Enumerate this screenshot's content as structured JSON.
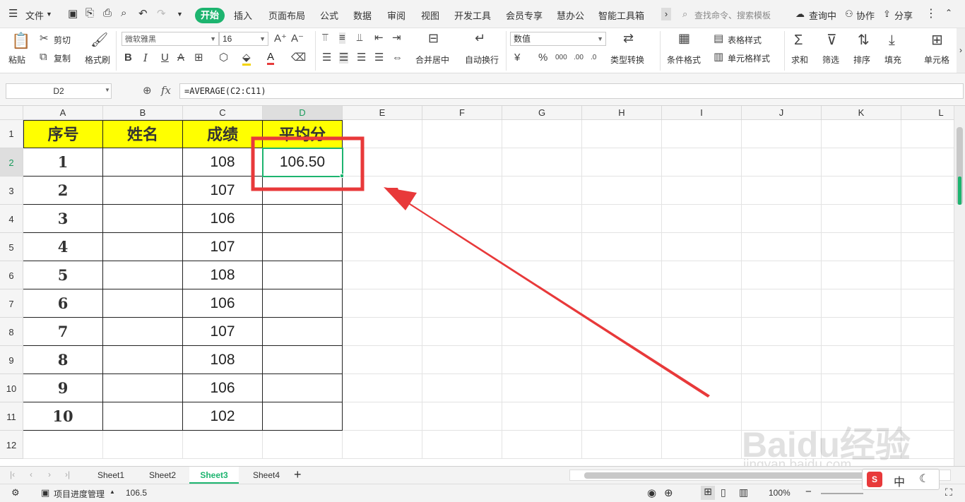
{
  "menubar": {
    "file_label": "文件",
    "tabs": [
      "开始",
      "插入",
      "页面布局",
      "公式",
      "数据",
      "审阅",
      "视图",
      "开发工具",
      "会员专享",
      "慧办公",
      "智能工具箱"
    ],
    "search_placeholder": "查找命令、搜索模板",
    "right": [
      "查询中",
      "协作",
      "分享"
    ]
  },
  "ribbon": {
    "paste": "粘贴",
    "cut": "剪切",
    "copy": "复制",
    "format_painter": "格式刷",
    "font_name": "微软雅黑",
    "font_size": "16",
    "merge_center": "合并居中",
    "wrap_text": "自动换行",
    "number_format": "数值",
    "type_convert": "类型转换",
    "conditional_format": "条件格式",
    "table_style": "表格样式",
    "cell_style": "单元格样式",
    "sum": "求和",
    "filter": "筛选",
    "sort": "排序",
    "fill": "填充",
    "cell": "单元格"
  },
  "formula_bar": {
    "name_box": "D2",
    "fx": "fx",
    "formula": "=AVERAGE(C2:C11)"
  },
  "sheet": {
    "columns": [
      "A",
      "B",
      "C",
      "D",
      "E",
      "F",
      "G",
      "H",
      "I",
      "J",
      "K",
      "L"
    ],
    "rows": [
      "1",
      "2",
      "3",
      "4",
      "5",
      "6",
      "7",
      "8",
      "9",
      "10",
      "11",
      "12"
    ],
    "headers": [
      "序号",
      "姓名",
      "成绩",
      "平均分"
    ],
    "indexes": [
      "1",
      "2",
      "3",
      "4",
      "5",
      "6",
      "7",
      "8",
      "9",
      "10"
    ],
    "scores": [
      "108",
      "107",
      "106",
      "107",
      "108",
      "106",
      "107",
      "108",
      "106",
      "102"
    ],
    "average": "106.50"
  },
  "tabs": {
    "sheets": [
      "Sheet1",
      "Sheet2",
      "Sheet3",
      "Sheet4"
    ],
    "active": "Sheet3"
  },
  "status": {
    "project": "项目进度管理",
    "value": "106.5",
    "zoom": "100%"
  },
  "watermark": {
    "brand": "Baidu经验",
    "url": "jingyan.baidu.com"
  },
  "colors": {
    "accent": "#1db46f",
    "highlight": "#ffff00",
    "annotation": "#e8393a"
  }
}
